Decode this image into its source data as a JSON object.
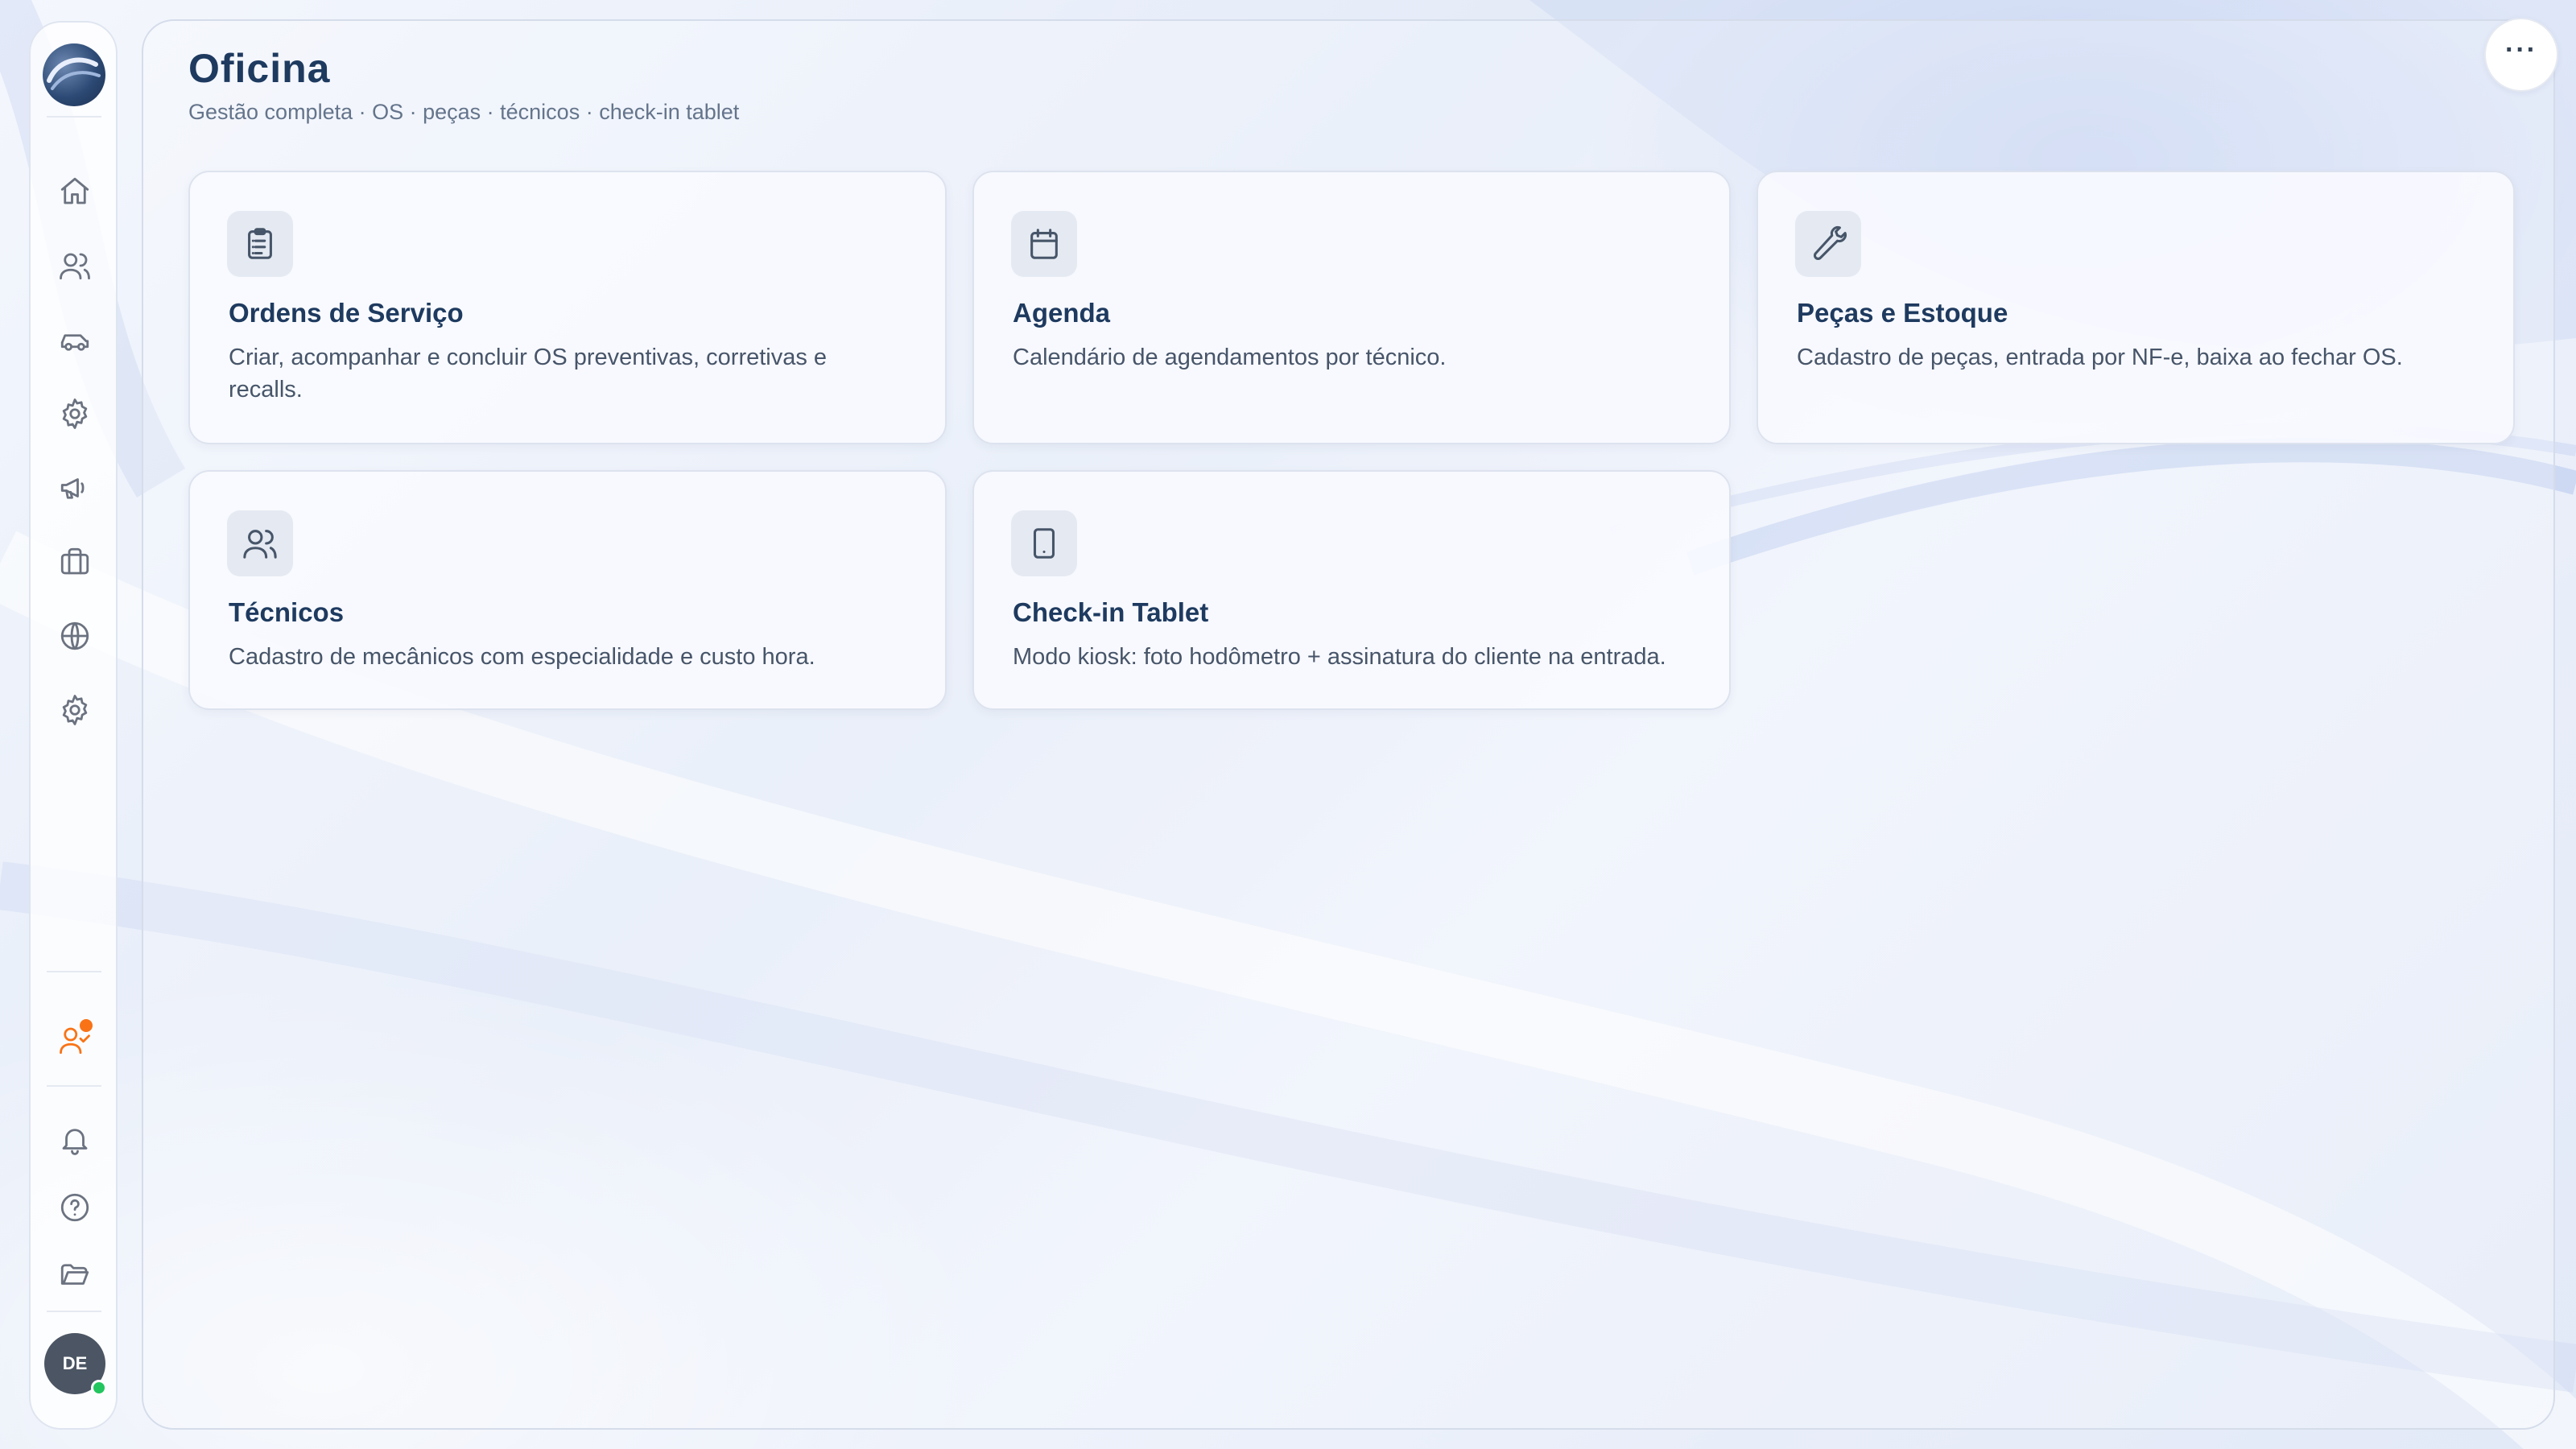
{
  "page": {
    "title": "Oficina",
    "subtitle": "Gestão completa · OS · peças · técnicos · check-in tablet",
    "more_label": "···"
  },
  "sidebar": {
    "items": [
      {
        "name": "home",
        "icon": "home-icon"
      },
      {
        "name": "users",
        "icon": "users-icon"
      },
      {
        "name": "vehicles",
        "icon": "car-icon"
      },
      {
        "name": "service-settings",
        "icon": "gear-icon"
      },
      {
        "name": "marketing",
        "icon": "megaphone-icon"
      },
      {
        "name": "business",
        "icon": "briefcase-icon"
      },
      {
        "name": "web",
        "icon": "globe-icon"
      },
      {
        "name": "settings",
        "icon": "gear-icon"
      }
    ],
    "bottom_items": [
      {
        "name": "user-check",
        "icon": "user-check-icon",
        "has_notification": true
      },
      {
        "name": "notifications",
        "icon": "bell-icon"
      },
      {
        "name": "help",
        "icon": "help-circle-icon"
      },
      {
        "name": "files",
        "icon": "folder-open-icon"
      }
    ],
    "avatar_initials": "DE",
    "avatar_status": "online"
  },
  "cards": [
    {
      "title": "Ordens de Serviço",
      "description": "Criar, acompanhar e concluir OS preventivas, corretivas e recalls.",
      "icon": "clipboard-list-icon"
    },
    {
      "title": "Agenda",
      "description": "Calendário de agendamentos por técnico.",
      "icon": "calendar-icon"
    },
    {
      "title": "Peças e Estoque",
      "description": "Cadastro de peças, entrada por NF-e, baixa ao fechar OS.",
      "icon": "wrench-icon"
    },
    {
      "title": "Técnicos",
      "description": "Cadastro de mecânicos com especialidade e custo hora.",
      "icon": "users-icon"
    },
    {
      "title": "Check-in Tablet",
      "description": "Modo kiosk: foto hodômetro + assinatura do cliente na entrada.",
      "icon": "tablet-icon"
    }
  ],
  "colors": {
    "accent_title": "#1e3a5f",
    "notification": "#f97316",
    "online": "#22c55e"
  }
}
